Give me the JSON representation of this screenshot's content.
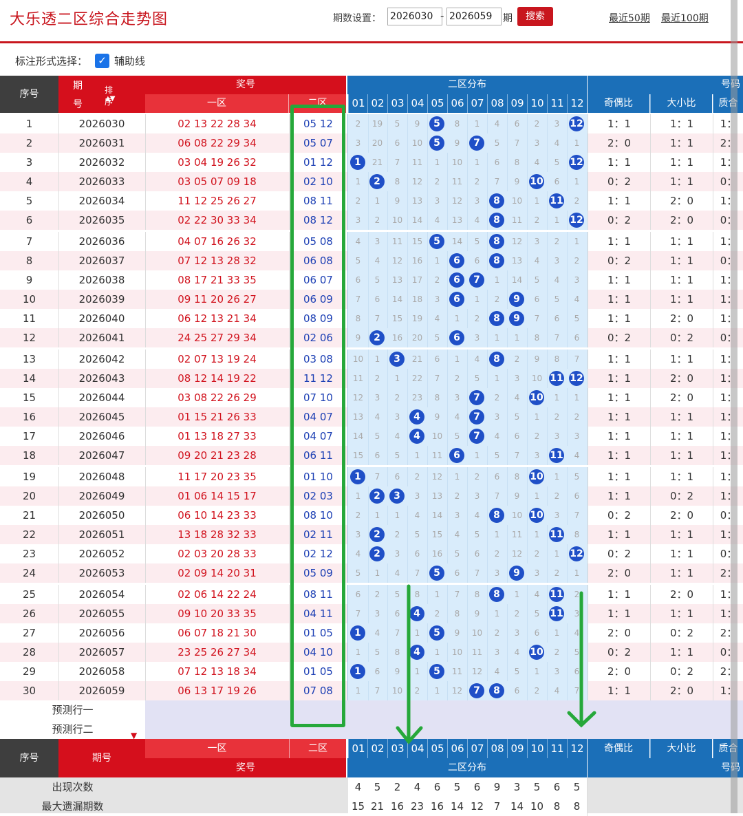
{
  "app_title": "大乐透二区综合走势图",
  "period": {
    "label": "期数设置：",
    "from": "2026030",
    "to": "2026059",
    "suffix": "期",
    "search": "搜索"
  },
  "links": {
    "recent50": "最近50期",
    "recent100": "最近100期"
  },
  "options": {
    "label": "标注形式选择：",
    "checkbox_checked": true,
    "checkbox_text": "辅助线"
  },
  "header": {
    "seq": "序号",
    "period_top": "期",
    "period_bottom": "号",
    "sort": "排序",
    "prize": "奖号",
    "zone1": "一区",
    "zone2": "二区",
    "dist": "二区分布",
    "numtype": "号码",
    "odd_even": "奇偶比",
    "big_small": "大小比",
    "prime": "质合",
    "cols": [
      "01",
      "02",
      "03",
      "04",
      "05",
      "06",
      "07",
      "08",
      "09",
      "10",
      "11",
      "12"
    ]
  },
  "rows": [
    {
      "seq": "1",
      "period": "2026030",
      "zone1": "02 13 22 28 34",
      "zone2": "05 12",
      "miss": [
        "2",
        "19",
        "5",
        "9",
        null,
        "8",
        "1",
        "4",
        "6",
        "2",
        "3",
        null
      ],
      "balls": [
        5,
        12
      ],
      "oe": "1：1",
      "bs": "1：1"
    },
    {
      "seq": "2",
      "period": "2026031",
      "zone1": "06 08 22 29 34",
      "zone2": "05 07",
      "miss": [
        "3",
        "20",
        "6",
        "10",
        null,
        "9",
        null,
        "5",
        "7",
        "3",
        "4",
        "1"
      ],
      "balls": [
        5,
        7
      ],
      "oe": "2：0",
      "bs": "1：1"
    },
    {
      "seq": "3",
      "period": "2026032",
      "zone1": "03 04 19 26 32",
      "zone2": "01 12",
      "miss": [
        null,
        "21",
        "7",
        "11",
        "1",
        "10",
        "1",
        "6",
        "8",
        "4",
        "5",
        null
      ],
      "balls": [
        1,
        12
      ],
      "oe": "1：1",
      "bs": "1：1"
    },
    {
      "seq": "4",
      "period": "2026033",
      "zone1": "03 05 07 09 18",
      "zone2": "02 10",
      "miss": [
        "1",
        null,
        "8",
        "12",
        "2",
        "11",
        "2",
        "7",
        "9",
        null,
        "6",
        "1"
      ],
      "balls": [
        2,
        10
      ],
      "oe": "0：2",
      "bs": "1：1"
    },
    {
      "seq": "5",
      "period": "2026034",
      "zone1": "11 12 25 26 27",
      "zone2": "08 11",
      "miss": [
        "2",
        "1",
        "9",
        "13",
        "3",
        "12",
        "3",
        null,
        "10",
        "1",
        null,
        "2"
      ],
      "balls": [
        8,
        11
      ],
      "oe": "1：1",
      "bs": "2：0"
    },
    {
      "seq": "6",
      "period": "2026035",
      "zone1": "02 22 30 33 34",
      "zone2": "08 12",
      "miss": [
        "3",
        "2",
        "10",
        "14",
        "4",
        "13",
        "4",
        null,
        "11",
        "2",
        "1",
        null
      ],
      "balls": [
        8,
        12
      ],
      "oe": "0：2",
      "bs": "2：0"
    },
    {
      "seq": "7",
      "period": "2026036",
      "zone1": "04 07 16 26 32",
      "zone2": "05 08",
      "miss": [
        "4",
        "3",
        "11",
        "15",
        null,
        "14",
        "5",
        null,
        "12",
        "3",
        "2",
        "1"
      ],
      "balls": [
        5,
        8
      ],
      "oe": "1：1",
      "bs": "1：1"
    },
    {
      "seq": "8",
      "period": "2026037",
      "zone1": "07 12 13 28 32",
      "zone2": "06 08",
      "miss": [
        "5",
        "4",
        "12",
        "16",
        "1",
        null,
        "6",
        null,
        "13",
        "4",
        "3",
        "2"
      ],
      "balls": [
        6,
        8
      ],
      "oe": "0：2",
      "bs": "1：1"
    },
    {
      "seq": "9",
      "period": "2026038",
      "zone1": "08 17 21 33 35",
      "zone2": "06 07",
      "miss": [
        "6",
        "5",
        "13",
        "17",
        "2",
        null,
        null,
        "1",
        "14",
        "5",
        "4",
        "3"
      ],
      "balls": [
        6,
        7
      ],
      "oe": "1：1",
      "bs": "1：1"
    },
    {
      "seq": "10",
      "period": "2026039",
      "zone1": "09 11 20 26 27",
      "zone2": "06 09",
      "miss": [
        "7",
        "6",
        "14",
        "18",
        "3",
        null,
        "1",
        "2",
        null,
        "6",
        "5",
        "4"
      ],
      "balls": [
        6,
        9
      ],
      "oe": "1：1",
      "bs": "1：1"
    },
    {
      "seq": "11",
      "period": "2026040",
      "zone1": "06 12 13 21 34",
      "zone2": "08 09",
      "miss": [
        "8",
        "7",
        "15",
        "19",
        "4",
        "1",
        "2",
        null,
        null,
        "7",
        "6",
        "5"
      ],
      "balls": [
        8,
        9
      ],
      "oe": "1：1",
      "bs": "2：0"
    },
    {
      "seq": "12",
      "period": "2026041",
      "zone1": "24 25 27 29 34",
      "zone2": "02 06",
      "miss": [
        "9",
        null,
        "16",
        "20",
        "5",
        null,
        "3",
        "1",
        "1",
        "8",
        "7",
        "6"
      ],
      "balls": [
        2,
        6
      ],
      "oe": "0：2",
      "bs": "0：2"
    },
    {
      "seq": "13",
      "period": "2026042",
      "zone1": "02 07 13 19 24",
      "zone2": "03 08",
      "miss": [
        "10",
        "1",
        null,
        "21",
        "6",
        "1",
        "4",
        null,
        "2",
        "9",
        "8",
        "7"
      ],
      "balls": [
        3,
        8
      ],
      "oe": "1：1",
      "bs": "1：1"
    },
    {
      "seq": "14",
      "period": "2026043",
      "zone1": "08 12 14 19 22",
      "zone2": "11 12",
      "miss": [
        "11",
        "2",
        "1",
        "22",
        "7",
        "2",
        "5",
        "1",
        "3",
        "10",
        null,
        null
      ],
      "balls": [
        11,
        12
      ],
      "oe": "1：1",
      "bs": "2：0"
    },
    {
      "seq": "15",
      "period": "2026044",
      "zone1": "03 08 22 26 29",
      "zone2": "07 10",
      "miss": [
        "12",
        "3",
        "2",
        "23",
        "8",
        "3",
        null,
        "2",
        "4",
        null,
        "1",
        "1"
      ],
      "balls": [
        7,
        10
      ],
      "oe": "1：1",
      "bs": "2：0"
    },
    {
      "seq": "16",
      "period": "2026045",
      "zone1": "01 15 21 26 33",
      "zone2": "04 07",
      "miss": [
        "13",
        "4",
        "3",
        null,
        "9",
        "4",
        null,
        "3",
        "5",
        "1",
        "2",
        "2"
      ],
      "balls": [
        4,
        7
      ],
      "oe": "1：1",
      "bs": "1：1"
    },
    {
      "seq": "17",
      "period": "2026046",
      "zone1": "01 13 18 27 33",
      "zone2": "04 07",
      "miss": [
        "14",
        "5",
        "4",
        null,
        "10",
        "5",
        null,
        "4",
        "6",
        "2",
        "3",
        "3"
      ],
      "balls": [
        4,
        7
      ],
      "oe": "1：1",
      "bs": "1：1"
    },
    {
      "seq": "18",
      "period": "2026047",
      "zone1": "09 20 21 23 28",
      "zone2": "06 11",
      "miss": [
        "15",
        "6",
        "5",
        "1",
        "11",
        null,
        "1",
        "5",
        "7",
        "3",
        null,
        "4"
      ],
      "balls": [
        6,
        11
      ],
      "oe": "1：1",
      "bs": "1：1"
    },
    {
      "seq": "19",
      "period": "2026048",
      "zone1": "11 17 20 23 35",
      "zone2": "01 10",
      "miss": [
        null,
        "7",
        "6",
        "2",
        "12",
        "1",
        "2",
        "6",
        "8",
        null,
        "1",
        "5"
      ],
      "balls": [
        1,
        10
      ],
      "oe": "1：1",
      "bs": "1：1"
    },
    {
      "seq": "20",
      "period": "2026049",
      "zone1": "01 06 14 15 17",
      "zone2": "02 03",
      "miss": [
        "1",
        null,
        null,
        "3",
        "13",
        "2",
        "3",
        "7",
        "9",
        "1",
        "2",
        "6"
      ],
      "balls": [
        2,
        3
      ],
      "oe": "1：1",
      "bs": "0：2"
    },
    {
      "seq": "21",
      "period": "2026050",
      "zone1": "06 10 14 23 33",
      "zone2": "08 10",
      "miss": [
        "2",
        "1",
        "1",
        "4",
        "14",
        "3",
        "4",
        null,
        "10",
        null,
        "3",
        "7"
      ],
      "balls": [
        8,
        10
      ],
      "oe": "0：2",
      "bs": "2：0"
    },
    {
      "seq": "22",
      "period": "2026051",
      "zone1": "13 18 28 32 33",
      "zone2": "02 11",
      "miss": [
        "3",
        null,
        "2",
        "5",
        "15",
        "4",
        "5",
        "1",
        "11",
        "1",
        null,
        "8"
      ],
      "balls": [
        2,
        11
      ],
      "oe": "1：1",
      "bs": "1：1"
    },
    {
      "seq": "23",
      "period": "2026052",
      "zone1": "02 03 20 28 33",
      "zone2": "02 12",
      "miss": [
        "4",
        null,
        "3",
        "6",
        "16",
        "5",
        "6",
        "2",
        "12",
        "2",
        "1",
        null
      ],
      "balls": [
        2,
        12
      ],
      "oe": "0：2",
      "bs": "1：1"
    },
    {
      "seq": "24",
      "period": "2026053",
      "zone1": "02 09 14 20 31",
      "zone2": "05 09",
      "miss": [
        "5",
        "1",
        "4",
        "7",
        null,
        "6",
        "7",
        "3",
        null,
        "3",
        "2",
        "1"
      ],
      "balls": [
        5,
        9
      ],
      "oe": "2：0",
      "bs": "1：1"
    },
    {
      "seq": "25",
      "period": "2026054",
      "zone1": "02 06 14 22 24",
      "zone2": "08 11",
      "miss": [
        "6",
        "2",
        "5",
        "8",
        "1",
        "7",
        "8",
        null,
        "1",
        "4",
        null,
        "2"
      ],
      "balls": [
        8,
        11
      ],
      "oe": "1：1",
      "bs": "2：0"
    },
    {
      "seq": "26",
      "period": "2026055",
      "zone1": "09 10 20 33 35",
      "zone2": "04 11",
      "miss": [
        "7",
        "3",
        "6",
        null,
        "2",
        "8",
        "9",
        "1",
        "2",
        "5",
        null,
        "3"
      ],
      "balls": [
        4,
        11
      ],
      "oe": "1：1",
      "bs": "1：1"
    },
    {
      "seq": "27",
      "period": "2026056",
      "zone1": "06 07 18 21 30",
      "zone2": "01 05",
      "miss": [
        null,
        "4",
        "7",
        "1",
        null,
        "9",
        "10",
        "2",
        "3",
        "6",
        "1",
        "4"
      ],
      "balls": [
        1,
        5
      ],
      "oe": "2：0",
      "bs": "0：2"
    },
    {
      "seq": "28",
      "period": "2026057",
      "zone1": "23 25 26 27 34",
      "zone2": "04 10",
      "miss": [
        "1",
        "5",
        "8",
        null,
        "1",
        "10",
        "11",
        "3",
        "4",
        null,
        "2",
        "5"
      ],
      "balls": [
        4,
        10
      ],
      "oe": "0：2",
      "bs": "1：1"
    },
    {
      "seq": "29",
      "period": "2026058",
      "zone1": "07 12 13 18 34",
      "zone2": "01 05",
      "miss": [
        null,
        "6",
        "9",
        "1",
        null,
        "11",
        "12",
        "4",
        "5",
        "1",
        "3",
        "6"
      ],
      "balls": [
        1,
        5
      ],
      "oe": "2：0",
      "bs": "0：2"
    },
    {
      "seq": "30",
      "period": "2026059",
      "zone1": "06 13 17 19 26",
      "zone2": "07 08",
      "miss": [
        "1",
        "7",
        "10",
        "2",
        "1",
        "12",
        null,
        null,
        "6",
        "2",
        "4",
        "7"
      ],
      "balls": [
        7,
        8
      ],
      "oe": "1：1",
      "bs": "2：0"
    }
  ],
  "predict": {
    "row1": "预测行一",
    "row2": "预测行二"
  },
  "footer": {
    "seq": "序号",
    "period": "期号",
    "zone1": "一区",
    "zone2": "二区",
    "prize": "奖号",
    "dist": "二区分布",
    "numtype": "号码",
    "odd_even": "奇偶比",
    "big_small": "大小比",
    "prime": "质合",
    "appear_label": "出现次数",
    "appear": [
      "4",
      "5",
      "2",
      "4",
      "6",
      "5",
      "6",
      "9",
      "3",
      "5",
      "6",
      "5"
    ],
    "maxmiss_label": "最大遗漏期数",
    "maxmiss": [
      "15",
      "21",
      "16",
      "23",
      "16",
      "14",
      "12",
      "7",
      "14",
      "10",
      "8",
      "8"
    ]
  },
  "colors": {
    "red": "#c8161e",
    "header_red": "#d50f1c",
    "blue_header": "#1b6fb8",
    "ball": "#1f4fc7",
    "green_annot": "#26a83a",
    "pink": "#fcecef",
    "dist_bg": "#d9ecfb"
  }
}
